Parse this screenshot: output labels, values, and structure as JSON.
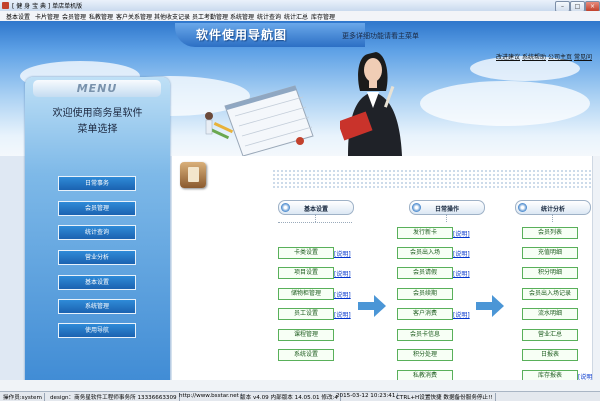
{
  "titlebar": {
    "title": "[ 健 身 宝 典 ] 单店单机版",
    "min": "–",
    "max": "□",
    "close": "×"
  },
  "menu": [
    "基本设置",
    "卡片管理",
    "会员管理",
    "私教管理",
    "客户关系管理",
    "其他收支记录",
    "员工考勤管理",
    "系统管理",
    "统计查询",
    "统计汇总",
    "库存管理"
  ],
  "header": {
    "title": "软件使用导航图",
    "subtitle": "更多详细功能请看主菜单",
    "links": [
      "改进建议",
      "系统帮助",
      "公司主页",
      "常见问"
    ]
  },
  "sidebar": {
    "menu_title": "MENU",
    "welcome": "欢迎使用商务星软件",
    "choose": "菜单选择",
    "buttons": [
      "日常事务",
      "会员管理",
      "统计查询",
      "营业分析",
      "基本设置",
      "系统管理",
      "使用导航"
    ]
  },
  "sections": {
    "basic": {
      "title": "基本设置",
      "items": [
        "卡类设置",
        "项目设置",
        "储物柜管理",
        "员工设置",
        "课程管理",
        "系统设置"
      ],
      "help": [
        "[说明]",
        "[说明]",
        "[说明]",
        "[说明]"
      ]
    },
    "daily": {
      "title": "日常操作",
      "items": [
        "发行新卡",
        "会员出入场",
        "会员请假",
        "会员续期",
        "客户消费",
        "会员卡信息",
        "积分处理",
        "私教消费"
      ],
      "help": [
        "[说明]",
        "[说明]",
        "[说明]",
        "[说明]"
      ]
    },
    "stats": {
      "title": "统计分析",
      "items": [
        "会员列表",
        "充值明细",
        "积分明细",
        "会员出入场记录",
        "流水明细",
        "营业汇总",
        "日报表",
        "库存报表"
      ],
      "help": [
        "[说明]",
        "[说明]"
      ]
    }
  },
  "status": {
    "operator": "操作员:system",
    "design": "design：商务星软件工程师事务所 13336663309",
    "website": "http://www.bsstar.net",
    "version": "版本 v4.09 内部版本 14.05.01 修改:4",
    "datetime": "2015-03-12 10:23:41",
    "hotkey": "CTRL+H设置快捷 数据备份服务停止!!"
  },
  "colors": {
    "accent": "#2c6fc4",
    "button_green": "#59b05a",
    "arrow": "#4b96d6"
  }
}
